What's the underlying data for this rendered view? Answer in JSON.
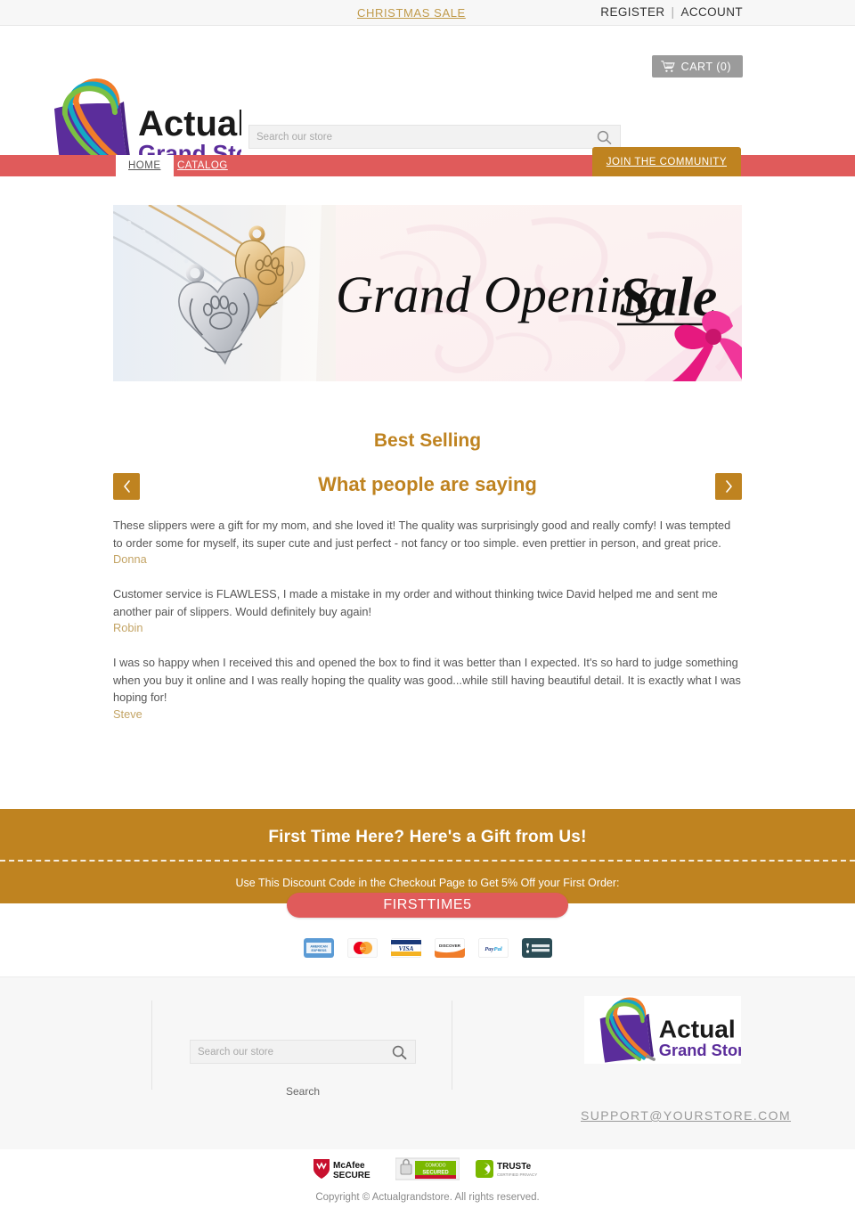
{
  "topbar": {
    "sale_label": "CHRISTMAS SALE",
    "register_label": "REGISTER",
    "separator": "|",
    "account_label": "ACCOUNT"
  },
  "cart": {
    "label": "CART (0)",
    "icon": "shopping-cart-icon",
    "count": 0
  },
  "brand": {
    "name_line1": "Actual",
    "name_line2": "Grand Store",
    "logo_colors": {
      "bag": "#5b2d9b",
      "arc_orange": "#f07d2a",
      "arc_teal": "#14a8c4",
      "arc_green": "#7bc043",
      "text_top": "#1a1a1a",
      "text_bottom": "#5b2d9b"
    }
  },
  "search": {
    "placeholder": "Search our store",
    "value": "",
    "icon": "search-icon"
  },
  "nav": {
    "items": [
      {
        "label": "HOME",
        "active": true
      },
      {
        "label": "CATALOG",
        "active": false
      }
    ],
    "cta_label": "JOIN THE COMMUNITY",
    "bar_color": "#e05b5b",
    "cta_color": "#bf8320"
  },
  "hero": {
    "headline": "Grand Opening Sale",
    "alt": "Heart locket necklaces with paw print engraving on pink damask background with pink ribbon bow"
  },
  "sections": {
    "best_selling": "Best Selling",
    "what_people": "What people are saying",
    "prev_icon": "chevron-left-icon",
    "next_icon": "chevron-right-icon"
  },
  "testimonials": [
    {
      "text": "These slippers were a gift for my mom, and she loved it! The quality was surprisingly good and really comfy! I was tempted to order some for myself, its super cute and just perfect - not fancy or too simple. even prettier in person, and great price.",
      "author": "Donna"
    },
    {
      "text": "Customer service is FLAWLESS, I made a mistake in my order and without thinking twice David helped me and sent me another pair of slippers. Would definitely buy again!",
      "author": "Robin"
    },
    {
      "text": "I was so happy when I received this and opened the box to find it was better than I expected. It's so hard to judge something when you buy it online and I was really hoping the quality was good...while still having beautiful detail. It is exactly what I was hoping for!",
      "author": "Steve"
    }
  ],
  "promo": {
    "title": "First Time Here? Here's a Gift from Us!",
    "subtitle": "Use This Discount Code in the Checkout Page to Get 5% Off your First Order:",
    "code": "FIRSTTIME5",
    "band_color": "#bf8320",
    "code_color": "#e05b5b"
  },
  "payments": [
    {
      "name": "amex-icon",
      "label": "AMERICAN EXPRESS"
    },
    {
      "name": "mastercard-icon",
      "label": "MasterCard"
    },
    {
      "name": "visa-icon",
      "label": "VISA"
    },
    {
      "name": "discover-icon",
      "label": "DISCOVER"
    },
    {
      "name": "paypal-icon",
      "label": "PayPal"
    },
    {
      "name": "amazon-payments-icon",
      "label": "amazon payments"
    }
  ],
  "footer": {
    "search_placeholder": "Search our store",
    "search_value": "",
    "search_button_label": "Search",
    "email": "SUPPORT@YOURSTORE.COM"
  },
  "trust_badges": [
    {
      "name": "mcafee-secure-badge",
      "line1": "McAfee",
      "line2": "SECURE"
    },
    {
      "name": "comodo-secured-badge",
      "line1": "COMODO",
      "line2": "SECURED"
    },
    {
      "name": "truste-badge",
      "line1": "TRUSTe",
      "line2": "CERTIFIED PRIVACY"
    }
  ],
  "copyright": "Copyright © Actualgrandstore. All rights reserved."
}
